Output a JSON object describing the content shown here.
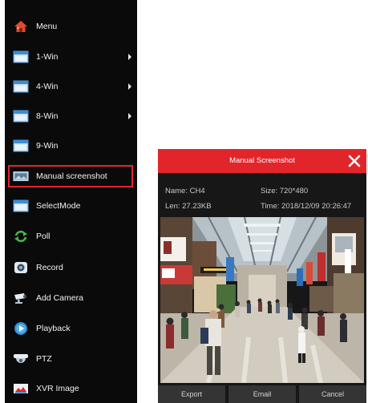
{
  "menu": {
    "items": [
      {
        "label": "Menu",
        "icon": "house-icon",
        "submenu": false
      },
      {
        "label": "1-Win",
        "icon": "window-icon",
        "submenu": true
      },
      {
        "label": "4-Win",
        "icon": "window-icon",
        "submenu": true
      },
      {
        "label": "8-Win",
        "icon": "window-icon",
        "submenu": true
      },
      {
        "label": "9-Win",
        "icon": "window-icon",
        "submenu": false
      },
      {
        "label": "Manual screenshot",
        "icon": "screenshot-icon",
        "submenu": false,
        "selected": true
      },
      {
        "label": "SelectMode",
        "icon": "window-icon",
        "submenu": false
      },
      {
        "label": "Poll",
        "icon": "cycle-icon",
        "submenu": false
      },
      {
        "label": "Record",
        "icon": "record-icon",
        "submenu": false
      },
      {
        "label": "Add Camera",
        "icon": "camera-icon",
        "submenu": false
      },
      {
        "label": "Playback",
        "icon": "playback-icon",
        "submenu": false
      },
      {
        "label": "PTZ",
        "icon": "ptz-icon",
        "submenu": false
      },
      {
        "label": "XVR Image",
        "icon": "image-icon",
        "submenu": false
      }
    ]
  },
  "dialog": {
    "title": "Manual Screenshot",
    "name_label": "Name:",
    "name_value": "CH4",
    "size_label": "Size:",
    "size_value": "720*480",
    "len_label": "Len:",
    "len_value": "27.23KB",
    "time_label": "Time:",
    "time_value": "2018/12/09 20:26:47",
    "buttons": {
      "export": "Export",
      "email": "Email",
      "cancel": "Cancel"
    }
  },
  "colors": {
    "accent": "#e2252b",
    "menu_background": "#0a0a0a",
    "dialog_background": "#171717",
    "button_background": "#343434"
  }
}
